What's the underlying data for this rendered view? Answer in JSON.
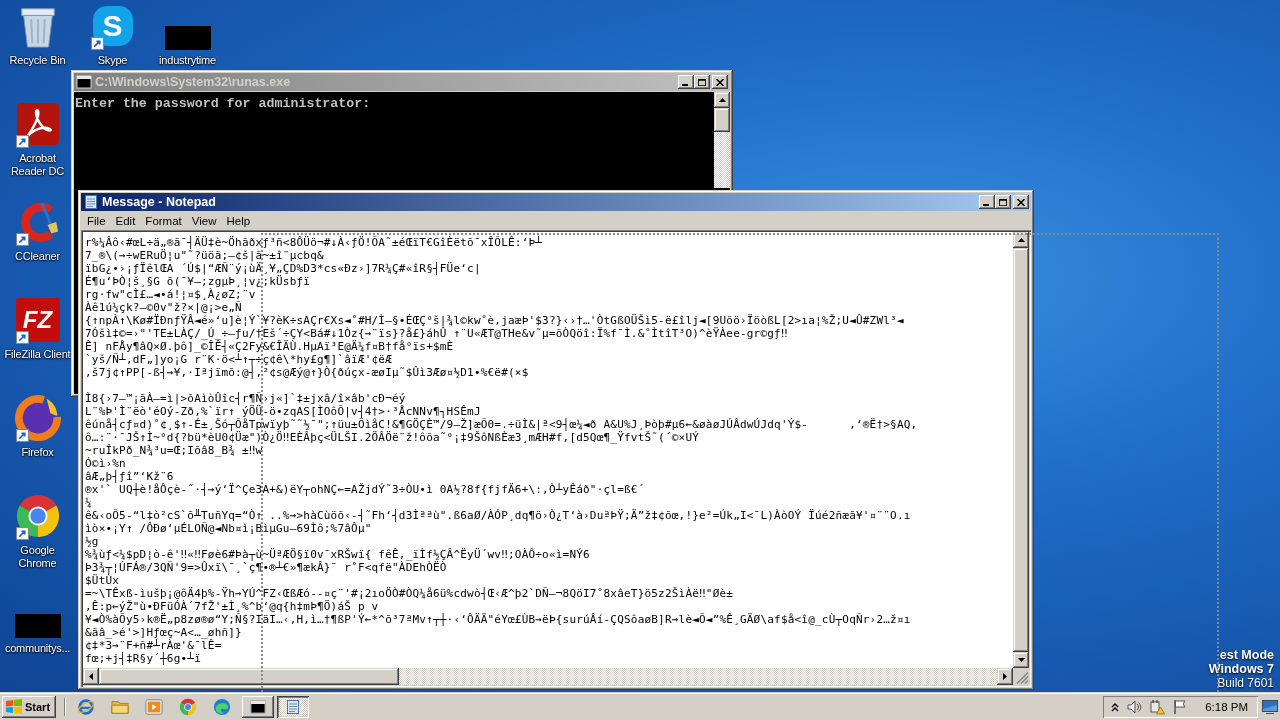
{
  "desktop_icons": [
    {
      "label": "Recycle Bin",
      "kind": "recycle-bin",
      "shortcut": false
    },
    {
      "label": "Skype",
      "kind": "skype",
      "logo": "S",
      "shortcut": true
    },
    {
      "label": "industrytime",
      "kind": "thumbnail",
      "shortcut": false
    },
    {
      "label": "Acrobat Reader DC",
      "kind": "acrobat",
      "shortcut": true
    },
    {
      "label": "CCleaner",
      "kind": "ccleaner",
      "shortcut": true
    },
    {
      "label": "FileZilla Client",
      "kind": "filezilla",
      "logo": "FZ",
      "shortcut": true
    },
    {
      "label": "Firefox",
      "kind": "firefox",
      "shortcut": true
    },
    {
      "label": "Google Chrome",
      "kind": "chrome",
      "shortcut": true
    },
    {
      "label": "communitys...",
      "kind": "thumbnail",
      "shortcut": false
    }
  ],
  "console_window": {
    "title": "C:\\Windows\\System32\\runas.exe",
    "text": "Enter the password for administrator:"
  },
  "notepad_window": {
    "title": "Message - Notepad",
    "menu": [
      "File",
      "Edit",
      "Format",
      "View",
      "Help"
    ],
    "paragraphs": [
      [
        "r%¼Âô‹#œL÷ä„®ã¯┤ÄÜ‡è~Öhãðxƒ³ñ<8ÔÜö¬#↓À‹ƒÖ!ÕA˜±éŒïT€GîÈëtõ¯xÎÕLÊ:‘Þ┴",
        "7_®\\(→÷wERuÖ¦u\"˜?üöã;—¢š|ã~±î¨µcbq&",
        "ïbG¿•›¡ƒÏêlŒA ´Ú$|“ÆÑ¨ý¡ùÄ¸¥„ÇD%D3*cs«Ðz›]7R¼Ç#«îR§┤FÜe‘c|",
        "É¶u‘ÞÒ¦š¸§G õ(¯¥—;zgµÞ¸¦v¿;kÜsbƒï",
        "rg·fw\"cÌ£…◄•á!¦¤$¸À¿øZ;¨v",
        "Àê1ú¼çk?—©0v\"ž?×|@¡>e„Ñ",
        "{↑npÀ↑\\Kø#ÏÐnƒŸÂ◄é»‘u]è¦Ý`¥?èK÷sAÇr€Xs◄˚#H/Ì—§•ÉŒÇ°š|¾l©kw˚è,jaæÞ'$3?}‹›†…'ÒtGßOÜŠì5-ë£îlj◄[9Uõö›ÏöòßL[2>ıa¦%Ž;U◄Û#ZWl³◄",
        "7Óšì‡©=›\"'TE±LÀÇ/_Ú_÷—ƒu/†Eš´÷ÇY<Bá#↓1Òz{→¨ïs}?å£}áhÛ ↑¨U«ÆT@THe&v˜µ=õÒQöî:Ï%f¯Ì.&˚ÌtîT³O)^èŸÀee-gr©gƒ‼",
        "Ê] nFÅy¶âQ×Ø.þô]_©ÎÊ┤«Ç2Fy&€ÎÄÙ.HµAï³E@Ä¼f¤B†få°ïs+$mÈ",
        "`yš/Ñ┴,dF„]yo¡G r¨K·ö<┴↑┬÷ç¢ê\\*hy£g¶]`âïÆ'¢ëÆ",
        ",š7j¢↑PP[-ß┤→¥,·Iªjïmõ:@┤,²¢s@Æý@↑}Ò{ðúçx-æøIµ˜$Ûì3Æø¤½D1•%€ë#(×$"
      ],
      [
        "Ì8{›7—™¡ãÀ—=ì|>õAìòÛîc┤r¶Ñ›j«]`‡±jxâ/î×âb'cÐ¬éý",
        "L¨%Þ'Ì¨ëò'éOý-Zð,%`ïr↑ ýÖÜ-ö•zqAS[ÌOôÕ|v┤4†>·³ÅcNNv¶┐HSÊmJ",
        "êúnå┤cƒ¤d)˚¢¸$↑-É±¸Šó┬ÕåTpwïyþ˜˜½¯\";↑üu±ÕìåC!&¶GÖÇÈ™/9—Ž]æÕ0=.÷üÌ&|ª<9┤œ¼◄ð A&U%J¸Þòþ#µ6←&øàøJÚÂdwÚJdq'Ý$-      ,‘®Ë†>§AQ,",
        "ô…:¨·¯JŠ↑Ì~°d{?bü*èU0¢Üæ\")Ò¿Ö‼EÈÂþç<ÜLŠI.2ÖÂÖë¨ž!ôõa˜°¡‡9ŠôNßÈæ3¸mÆH#f,[d5Qœ¶_ŸfvtŠ˜(´©×UÝ",
        "~ruÎkPð_N¾³u=Œ;Iõâ8_B¾ ±‼w",
        "Ó©ì›%n",
        "âÆ„þ┤ƒî”‘Kž¨6",
        "®x'` UQ┼è!åÔçè-˝·┤→ý‘Ï^Çe3A+&)ëY┬ohNÇ←=AŽjdÝ˜3÷ÒU•ì 0A½?8f{fjfÄ6+\\:,Ò┴yÊáð\"·çl=ß€´",
        "¼",
        "ê&‹oÕ5-“l‡ò²cS`õ╨TuñYq=“Ò↑ ..%→>hàCùöõ‹-┤˜Fh‘┤d3Ìªªù\".ß6aØ/ÀÓP¸dq¶ö›Ò¿T‘à›DuªÞŸ;Ä”ž‡¢õœ,!}e²=Úk„I<¯L)ÀòOÝ Ïúé2ñæã¥'¤¨¨O.ı",
        "ìò×•¡Y↑ /ÔÐø‘µÉLOÑ@◄Nb¤ì¡BìµGu—69Ìô;%7âÔµ\"",
        "½g",
        "%¾ùƒ<¼$pD¦ò-ê'‼«‼Føè6#Þà┬ù~ÜªÆÖ§ï0v¯xRŠwï{ fêÊ,_ïÌf½ÇÂ^ËyÜ´wv‼;OÀÔ÷o«ì=NÝ6",
        "Þ3¾┬¦ÚFÁ®/3QÑ'9=>Ûxï\\¯¸`ç¶•®┴€»¶ækÂ}¯ r˚F<qfë\"ÀDEhÒËÒ",
        "$ÜtÙx",
        "=~\\TÊxß-ìušþ¡@ôÄ4þ%-Ÿh→YÚ^FZ‹ŒßÆó--¤ç¨'#¡2ıoÖÒ#ÒQ¼å6ü%cdwò┤Œ‹Æ^þ2`DÑ—¬8QöI7˚8xâeT}ö5z2ŠìÀë‼\"Øè±",
        ",Ê:p←ýŽ\"ù•ÐFüÓÀ´7fŽ'±Ì¸%^b‘@q{h‡mÞ¶Ö)áŠ p v",
        "¥◄Ò%àÕy5›k®Ë„p8zø®ø“Y;Ñ§?IäI…‹,H,ì…†¶ßP'Ý←*^õ³7ªMv↑┬┼·‹‘ÔÄÄ\"éYœ£ÙB→ëÞ{surúÂí-ÇQSôaøB]R→lè◄Õ◄”%Ê¸GÄØ\\af$å<î@_cÙ┬OqÑr›2…ž¤ı",
        "&ãâ_>é'>]Hƒœç~A<…_øhñ]}",
        "¢‡*3→¨F+ñ#┴rÀœ'&¯lÊ=",
        "fœ;+j┤‡R§y´┼6g•┴ï"
      ]
    ]
  },
  "desktop_text": [
    "est Mode",
    "Windows 7",
    "Build 7601"
  ],
  "taskbar": {
    "start_label": "Start",
    "quick_launch": [
      {
        "kind": "ie"
      },
      {
        "kind": "explorer"
      },
      {
        "kind": "media-player"
      },
      {
        "kind": "chrome"
      },
      {
        "kind": "edge"
      }
    ],
    "windows": [
      {
        "kind": "console",
        "selected": false
      },
      {
        "kind": "notepad",
        "selected": true
      }
    ],
    "clock": "6:18 PM"
  }
}
